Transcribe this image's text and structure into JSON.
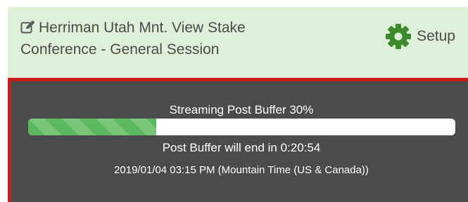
{
  "header": {
    "title": "Herriman Utah Mnt. View Stake Conference - General Session",
    "edit_icon": "edit-icon",
    "setup_label": "Setup",
    "setup_icon": "gear-icon"
  },
  "stream": {
    "status_label": "Streaming Post Buffer 30%",
    "progress_fraction": 0.3,
    "buffer_end_text": "Post Buffer will end in 0:20:54",
    "timestamp": "2019/01/04 03:15 PM (Mountain Time (US & Canada))"
  },
  "colors": {
    "header_bg": "#dff0d8",
    "panel_bg": "#4a4b4d",
    "panel_border": "#c91a1a",
    "progress_fill": "#5cb85c",
    "gear": "#3c8a2e"
  }
}
